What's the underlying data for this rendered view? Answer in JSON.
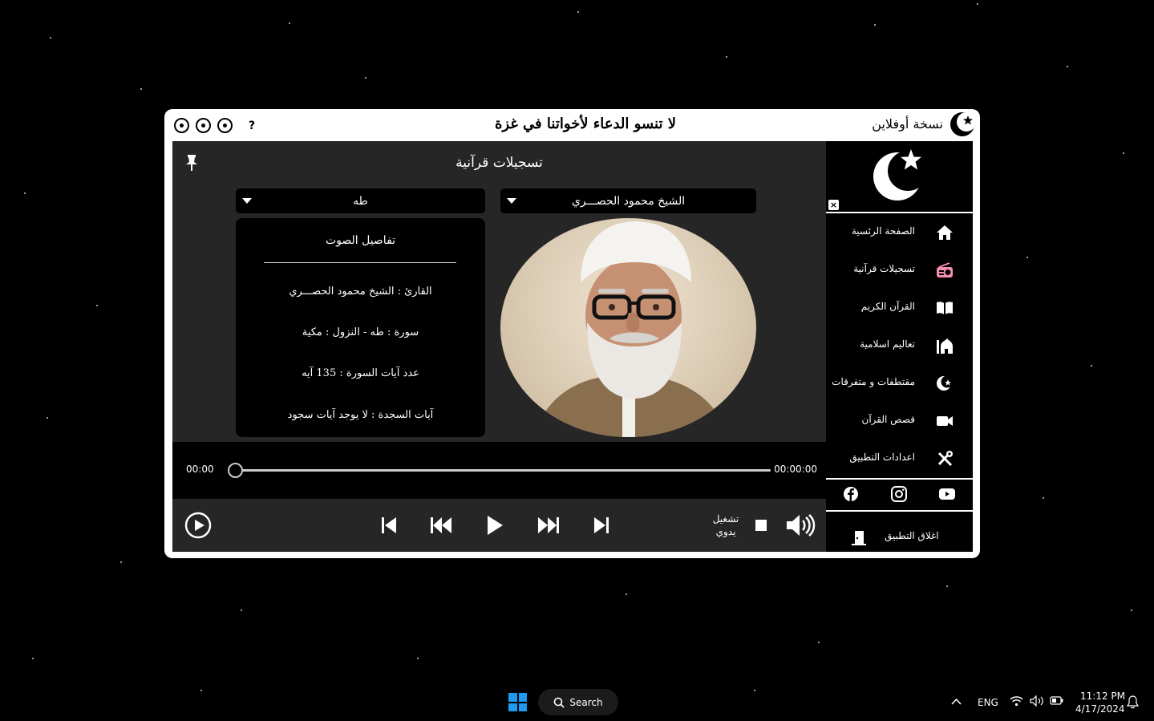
{
  "titlebar": {
    "help_label": "?",
    "center_message": "لا تنسو الدعاء لأخواتنا في غزة",
    "right_label": "نسخة أوفلاين"
  },
  "main": {
    "section_title": "تسجيلات قرآنية",
    "reader_dropdown": "الشيخ محمود الحصـــري",
    "surah_dropdown": "طه",
    "details": {
      "title": "تفاصيل الصوت",
      "reader": "القارئ : الشيخ محمود الحصـــري",
      "surah": "سورة  :  طه  -  النزول  :  مكية",
      "ayat_count": "عدد آيات السورة :  135  آيه",
      "sajda": "آيات السجدة  :  لا يوجد آيات سجود"
    },
    "progress": {
      "current_time": "00:00",
      "total_time": "00:00:00",
      "fraction": 0
    },
    "manual_play_label_1": "تشغيل",
    "manual_play_label_2": "يدوي"
  },
  "sidebar": {
    "items": [
      {
        "label": "الصفحة الرئسية",
        "icon": "home-icon"
      },
      {
        "label": "تسجيلات قرآنية",
        "icon": "radio-icon"
      },
      {
        "label": "القرآن الكريم",
        "icon": "book-icon"
      },
      {
        "label": "تعاليم اسلامية",
        "icon": "mosque-icon"
      },
      {
        "label": "مقتطفات و متفرقات",
        "icon": "crescent-icon"
      },
      {
        "label": "قصص القرآن",
        "icon": "video-icon"
      },
      {
        "label": "اعدادات التطبيق",
        "icon": "tools-icon"
      }
    ],
    "exit_label": "اغلاق التطبيق",
    "close_label": "×"
  },
  "taskbar": {
    "search_label": "Search",
    "language": "ENG",
    "time": "11:12 PM",
    "date": "4/17/2024"
  },
  "colors": {
    "active_icon": "#f48fb1",
    "window_bg": "#ffffff",
    "panel_bg": "#262626"
  }
}
